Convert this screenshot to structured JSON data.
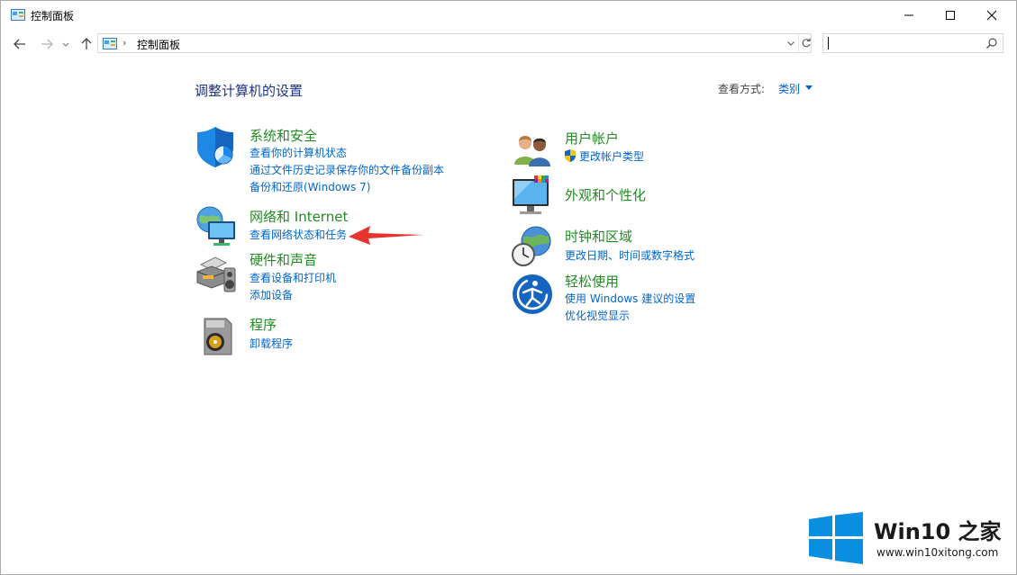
{
  "window": {
    "title": "控制面板",
    "icon": "control-panel-icon"
  },
  "address": {
    "path": "控制面板",
    "separator": "›",
    "search_value": "",
    "search_placeholder": ""
  },
  "header": {
    "title": "调整计算机的设置",
    "view_by_label": "查看方式:",
    "view_by_value": "类别"
  },
  "categories_left": [
    {
      "title": "系统和安全",
      "icon": "shield-icon",
      "links": [
        "查看你的计算机状态",
        "通过文件历史记录保存你的文件备份副本",
        "备份和还原(Windows 7)"
      ]
    },
    {
      "title": "网络和 Internet",
      "icon": "network-globe-icon",
      "links": [
        "查看网络状态和任务"
      ]
    },
    {
      "title": "硬件和声音",
      "icon": "printer-speaker-icon",
      "links": [
        "查看设备和打印机",
        "添加设备"
      ]
    },
    {
      "title": "程序",
      "icon": "programs-disc-icon",
      "links": [
        "卸载程序"
      ]
    }
  ],
  "categories_right": [
    {
      "title": "用户帐户",
      "icon": "users-icon",
      "links": [
        "更改帐户类型"
      ]
    },
    {
      "title": "外观和个性化",
      "icon": "monitor-palette-icon",
      "links": []
    },
    {
      "title": "时钟和区域",
      "icon": "clock-globe-icon",
      "links": [
        "更改日期、时间或数字格式"
      ]
    },
    {
      "title": "轻松使用",
      "icon": "ease-of-access-icon",
      "links": [
        "使用 Windows 建议的设置",
        "优化视觉显示"
      ]
    }
  ],
  "watermark": {
    "title": "Win10 之家",
    "url": "www.win10xitong.com"
  },
  "colors": {
    "accent_link": "#0066cc",
    "category_title": "#228b22",
    "page_title": "#1e3287",
    "arrow": "#e8332e",
    "win_logo": "#0a8fe0"
  }
}
